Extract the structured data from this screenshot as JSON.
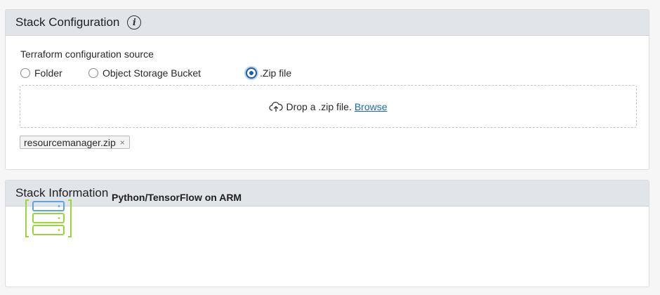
{
  "config_panel": {
    "title": "Stack Configuration",
    "info_icon": "info-icon",
    "source_label": "Terraform configuration source",
    "options": [
      "Folder",
      "Object Storage Bucket",
      ".Zip file"
    ],
    "selected_option": ".Zip file",
    "dropzone": {
      "icon": "cloud-upload-icon",
      "text": "Drop a .zip file.",
      "browse_label": "Browse"
    },
    "uploaded_file": {
      "name": "resourcemanager.zip",
      "remove_glyph": "×"
    }
  },
  "info_panel": {
    "title": "Stack Information",
    "logo_icon": "server-stack-icon",
    "stack_name": "Python/TensorFlow on ARM"
  },
  "colors": {
    "header_bg": "#e1e4e8",
    "accent": "#1f5f9e",
    "link": "#1a6bb4",
    "logo_blue": "#5aa7e0",
    "logo_green": "#9ad53a"
  }
}
